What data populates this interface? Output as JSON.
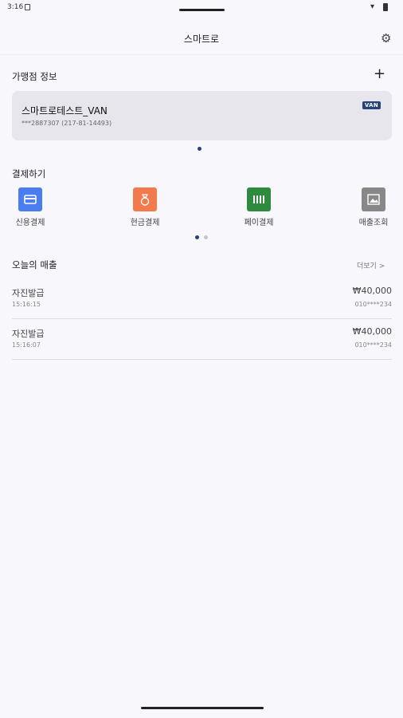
{
  "status_bar": {
    "time": "3:16"
  },
  "header": {
    "title": "스마트로",
    "settings_icon": "gear-icon"
  },
  "store_section": {
    "title": "가맹점 정보",
    "add_icon": "+",
    "card": {
      "name": "스마트로테스트_VAN",
      "details": "***2887307 (217-81-14493)",
      "badge": "VAN"
    }
  },
  "payment_section": {
    "title": "결제하기",
    "items": [
      {
        "label": "신용결제",
        "icon": "credit-card-icon",
        "color": "#4a7ef0"
      },
      {
        "label": "현금결제",
        "icon": "money-bag-icon",
        "color": "#f27a4d"
      },
      {
        "label": "페이결제",
        "icon": "barcode-icon",
        "color": "#2e8b3e"
      },
      {
        "label": "매출조회",
        "icon": "image-chart-icon",
        "color": "#888888"
      }
    ]
  },
  "sales_section": {
    "title": "오늘의 매출",
    "more_label": "더보기 >",
    "rows": [
      {
        "type": "자진발급",
        "time": "15:16:15",
        "amount": "₩40,000",
        "card": "010****234"
      },
      {
        "type": "자진발급",
        "time": "15:16:07",
        "amount": "₩40,000",
        "card": "010****234"
      }
    ]
  },
  "colors": {
    "accent": "#27417a",
    "background": "#f7f7fc"
  }
}
